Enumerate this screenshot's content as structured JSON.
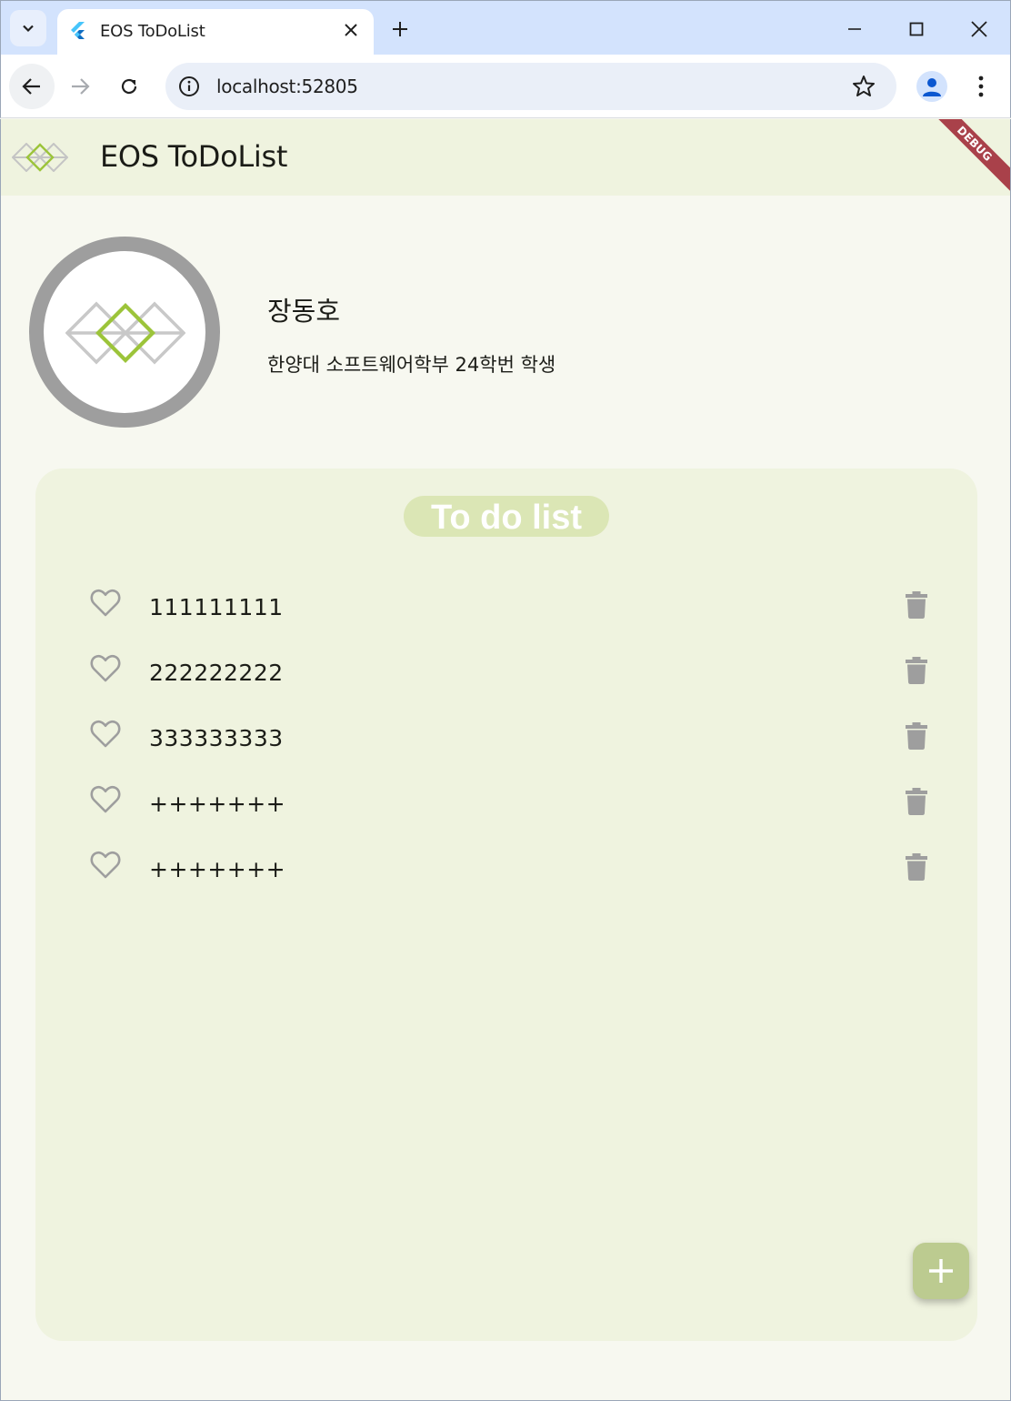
{
  "browser": {
    "tab_title": "EOS ToDoList",
    "url": "localhost:52805"
  },
  "app": {
    "title": "EOS ToDoList",
    "debug_banner": "DEBUG",
    "colors": {
      "appbar_bg": "#eff3df",
      "card_bg": "#eff3df",
      "title_pill": "#dbe6b5",
      "fab": "#bccb90",
      "accent_green": "#9cc43a",
      "icon_gray": "#9e9e9e"
    }
  },
  "profile": {
    "name": "장동호",
    "description": "한양대 소프트웨어학부 24학번 학생",
    "avatar_icon": "eos-logo-icon"
  },
  "todo": {
    "title": "To do list",
    "items": [
      {
        "text": "111111111",
        "liked": false
      },
      {
        "text": "222222222",
        "liked": false
      },
      {
        "text": "333333333",
        "liked": false
      },
      {
        "text": "+++++++",
        "liked": false
      },
      {
        "text": "+++++++",
        "liked": false
      }
    ],
    "add_button_icon": "plus-icon"
  }
}
